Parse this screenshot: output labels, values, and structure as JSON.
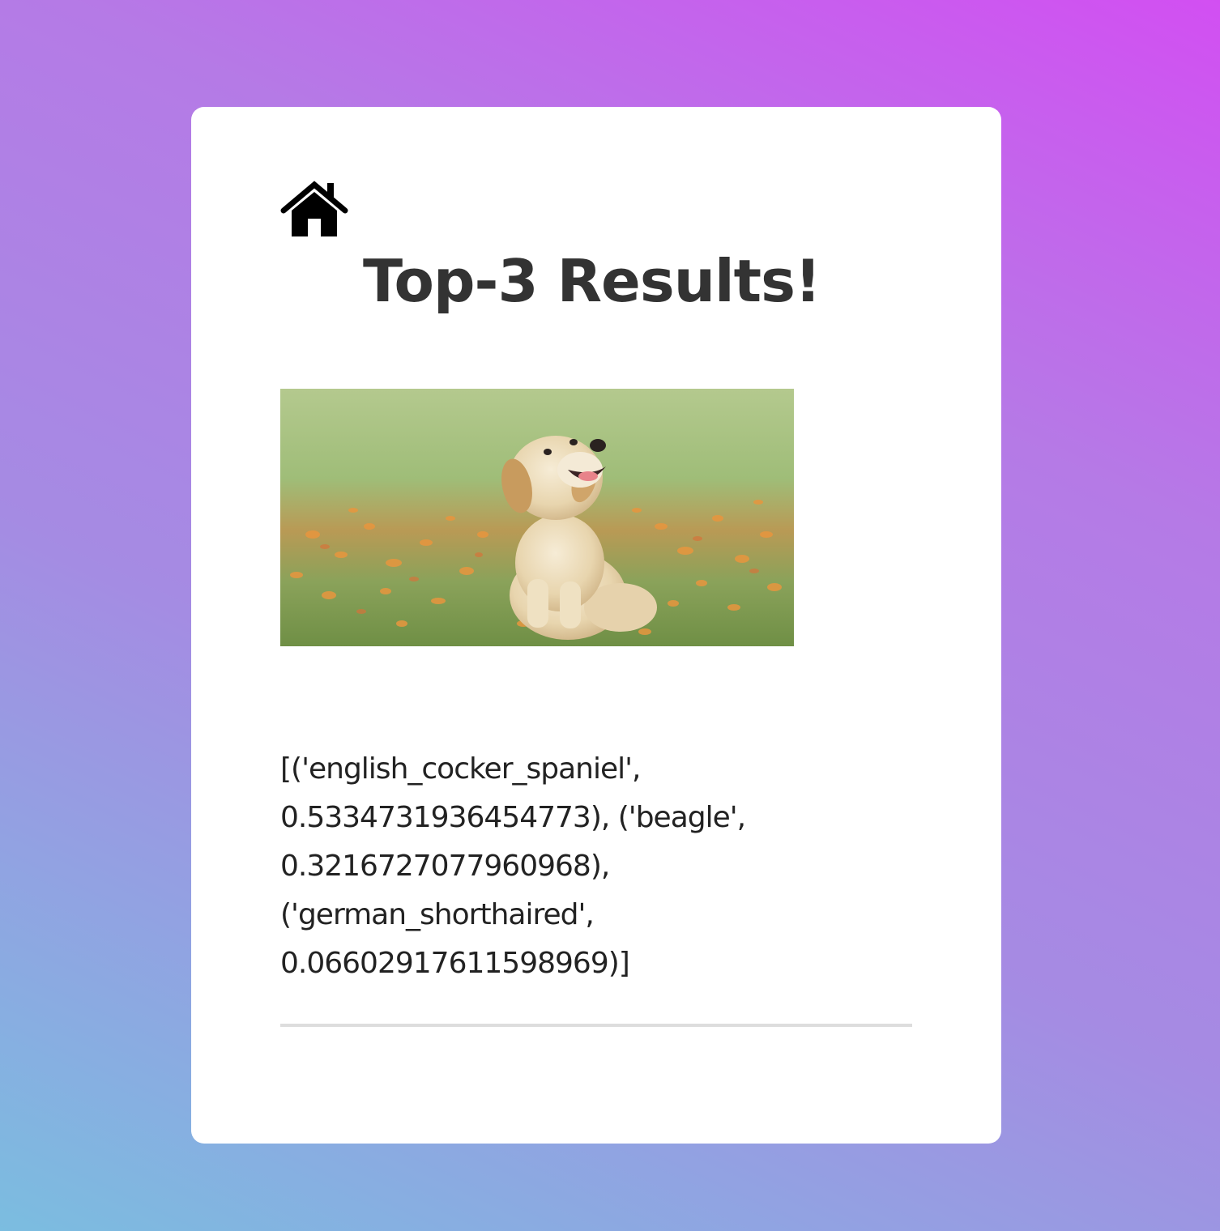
{
  "icons": {
    "home": "home-icon"
  },
  "page": {
    "title": "Top-3 Results!",
    "results_text": "[('english_cocker_spaniel',\n0.5334731936454773), ('beagle',\n0.3216727077960968),\n('german_shorthaired',\n0.06602917611598969)]"
  },
  "colors": {
    "gradient_top_right": "#d24ff2",
    "gradient_bottom_left": "#7bbde0",
    "card_background": "#ffffff",
    "title_text": "#333333",
    "divider": "#dddddd"
  }
}
